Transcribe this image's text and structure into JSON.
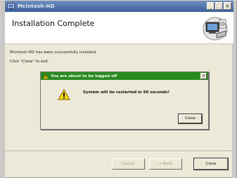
{
  "window": {
    "title": "Mcintosh-HD",
    "minimize_glyph": "_",
    "maximize_glyph": "□",
    "close_glyph": "×"
  },
  "header": {
    "title": "Installation Complete",
    "graphic_icon": "computer-setup-icon"
  },
  "body": {
    "line1": "Mcintosh-HD has been successfully installed.",
    "line2": "Click \"Close\" to exit."
  },
  "dialog": {
    "title": "You are about to be logged off",
    "message": "System will be restarted in 60 seconds!",
    "close_glyph": "×",
    "close_button_label": "Close",
    "title_color": "#2a8a20",
    "icon": "warning-icon"
  },
  "buttons": {
    "cancel_label": "Cancel",
    "back_label": "< Back",
    "close_label": "Close"
  }
}
